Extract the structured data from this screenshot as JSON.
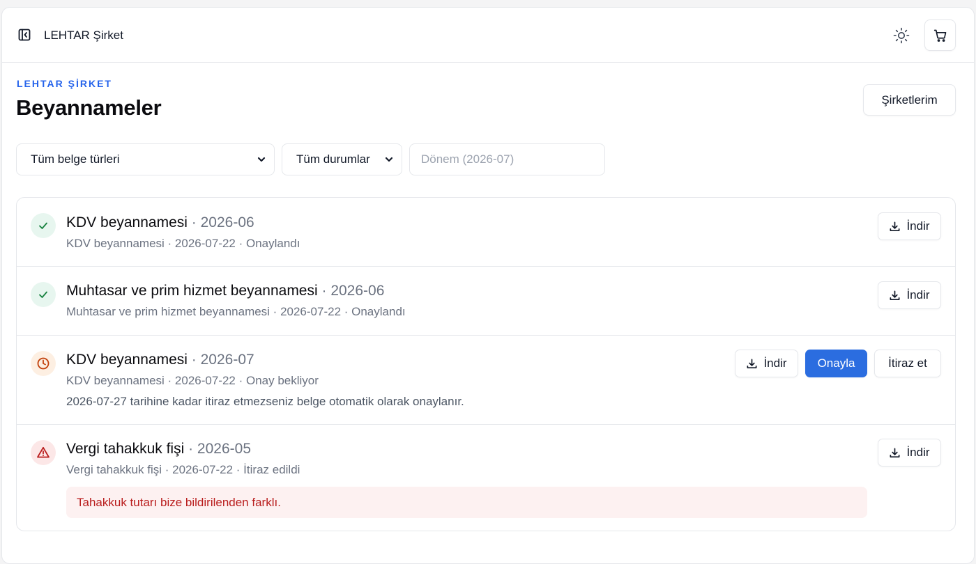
{
  "topbar": {
    "company_name": "LEHTAR Şirket",
    "icons": {
      "sidebar_toggle": "sidebar-collapse-icon",
      "theme": "sun-icon",
      "cart": "cart-icon"
    }
  },
  "header": {
    "eyebrow": "LEHTAR ŞİRKET",
    "title": "Beyannameler",
    "companies_button": "Şirketlerim"
  },
  "filters": {
    "document_type": "Tüm belge türleri",
    "status": "Tüm durumlar",
    "period_placeholder": "Dönem (2026-07)"
  },
  "colors": {
    "accent": "#2563eb",
    "primary_button": "#2b6de0",
    "approved": "#15803d",
    "pending": "#c2410c",
    "rejected": "#b91c1c"
  },
  "declarations": [
    {
      "status_icon": "check-icon",
      "title": "KDV beyannamesi",
      "period": "· 2026-06",
      "meta": "KDV beyannamesi · 2026-07-22 · Onaylandı",
      "download_label": "İndir"
    },
    {
      "status_icon": "check-icon",
      "title": "Muhtasar ve prim hizmet beyannamesi",
      "period": "· 2026-06",
      "meta": "Muhtasar ve prim hizmet beyannamesi · 2026-07-22 · Onaylandı",
      "download_label": "İndir"
    },
    {
      "status_icon": "clock-icon",
      "title": "KDV beyannamesi",
      "period": "· 2026-07",
      "meta": "KDV beyannamesi · 2026-07-22 · Onay bekliyor",
      "note": "2026-07-27 tarihine kadar itiraz etmezseniz belge otomatik olarak onaylanır.",
      "download_label": "İndir",
      "approve_label": "Onayla",
      "object_label": "İtiraz et"
    },
    {
      "status_icon": "warning-icon",
      "title": "Vergi tahakkuk fişi",
      "period": "· 2026-05",
      "meta": "Vergi tahakkuk fişi · 2026-07-22 · İtiraz edildi",
      "error": "Tahakkuk tutarı bize bildirilenden farklı.",
      "download_label": "İndir"
    }
  ]
}
